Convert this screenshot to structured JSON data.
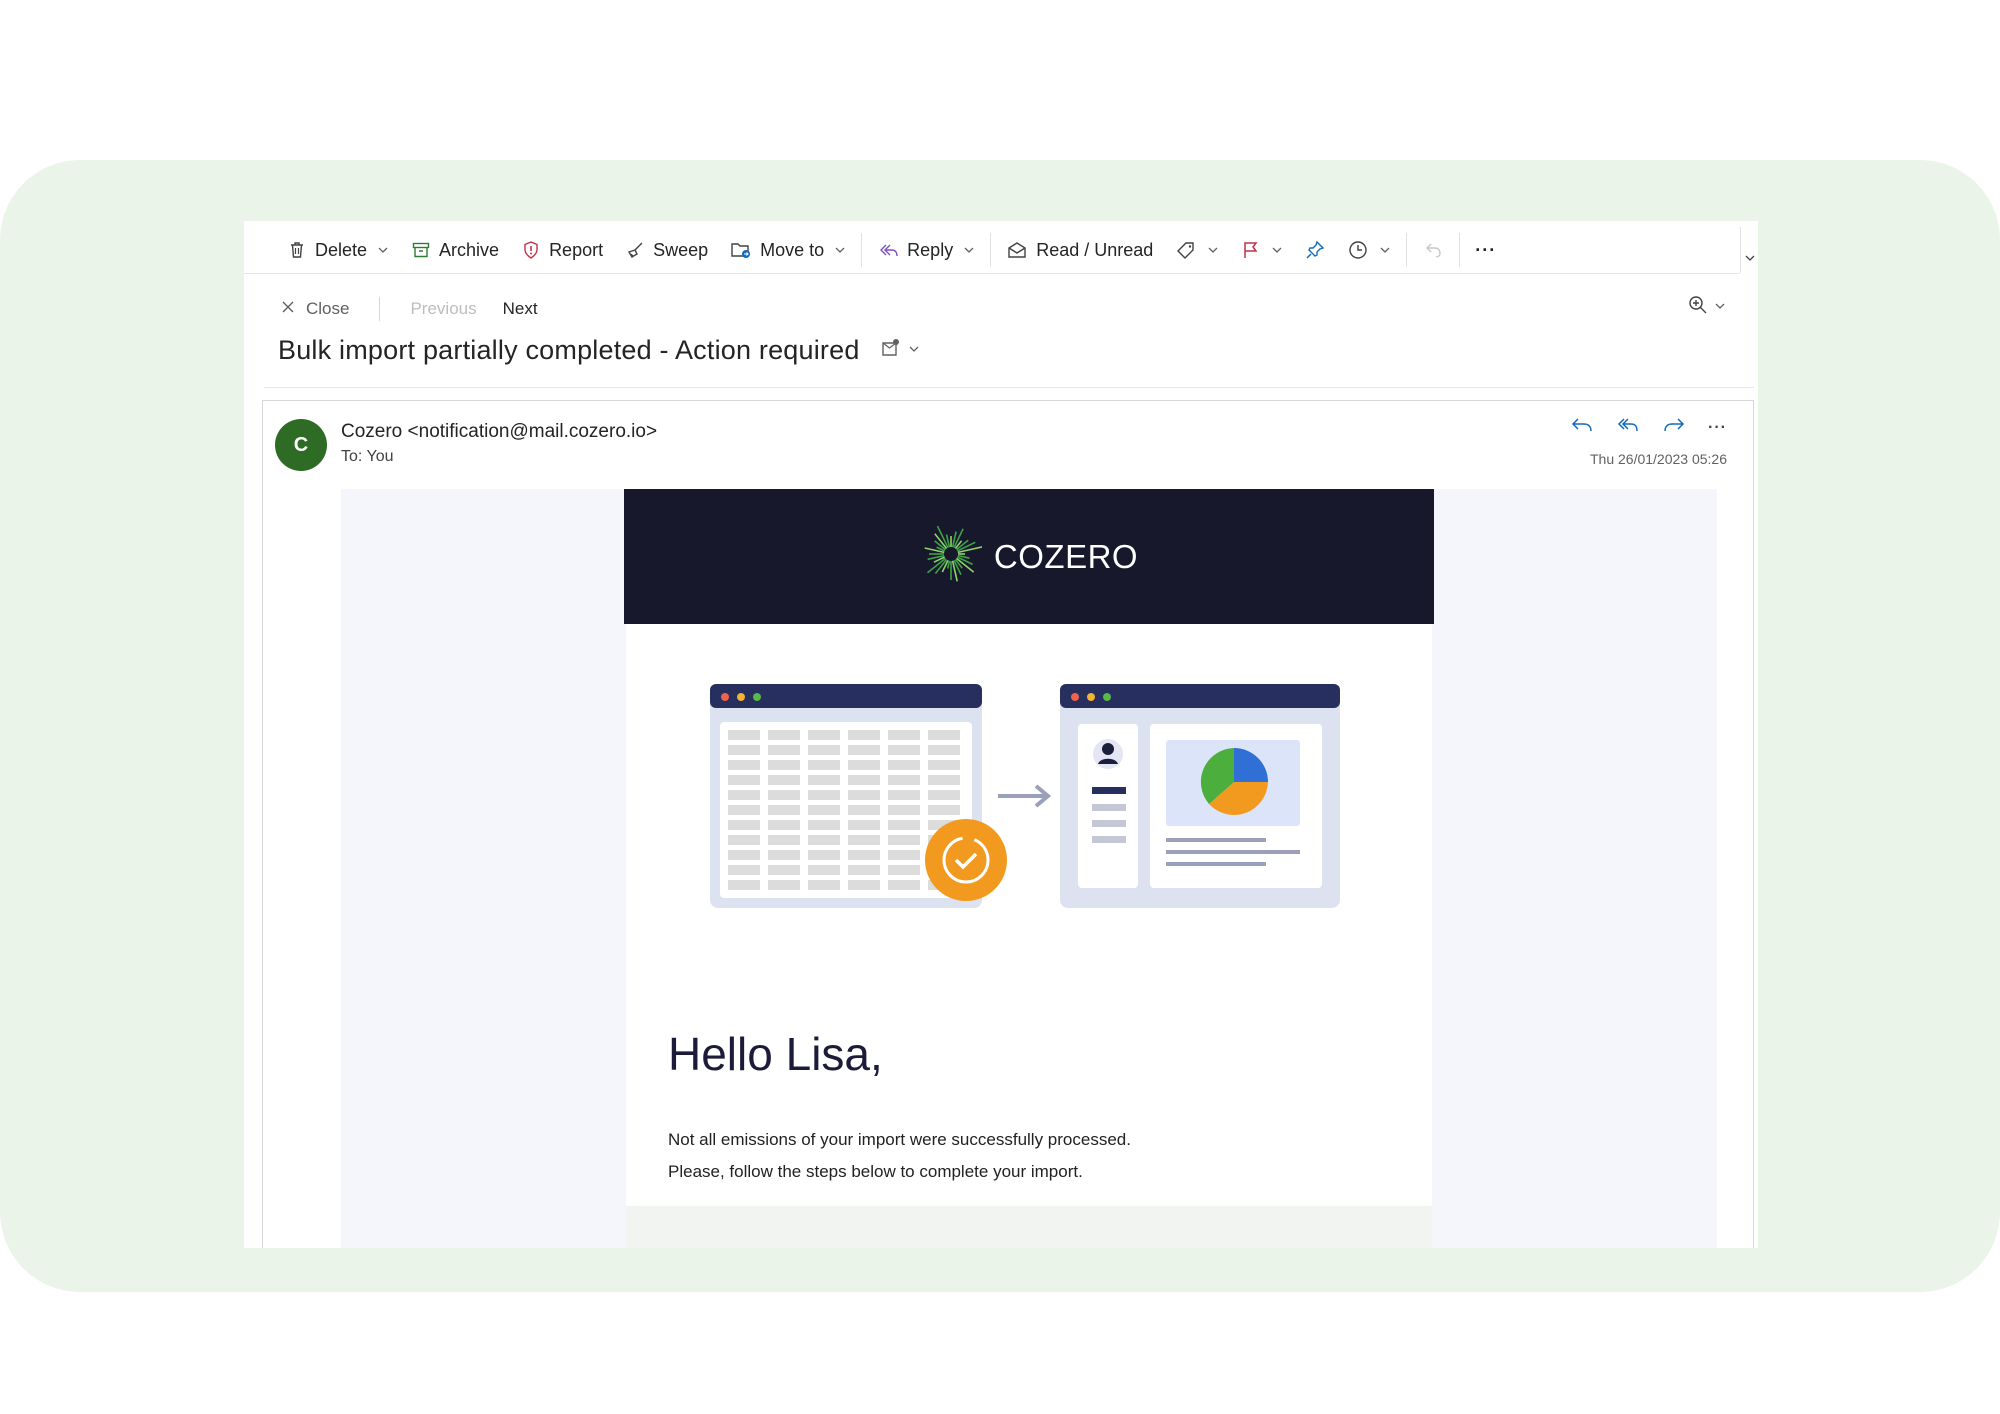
{
  "toolbar": {
    "delete_label": "Delete",
    "archive_label": "Archive",
    "report_label": "Report",
    "sweep_label": "Sweep",
    "move_to_label": "Move to",
    "reply_label": "Reply",
    "read_unread_label": "Read / Unread",
    "more_label": "···"
  },
  "nav": {
    "close_label": "Close",
    "previous_label": "Previous",
    "next_label": "Next"
  },
  "subject": "Bulk import partially completed - Action required",
  "message": {
    "avatar_initial": "C",
    "sender": "Cozero <notification@mail.cozero.io>",
    "to": "To:  You",
    "date": "Thu 26/01/2023 05:26",
    "more_label": "···"
  },
  "email": {
    "brand": "COZERO",
    "greeting": "Hello Lisa,",
    "line1": "Not all emissions of your import were successfully processed.",
    "line2": "Please, follow the steps below to complete your import."
  },
  "colors": {
    "backdrop": "#eaf4e8",
    "avatar": "#2e6b24",
    "email_header": "#17182b",
    "accent_orange": "#f29a1f",
    "accent_blue": "#2f6fd6",
    "accent_green": "#4cae3c"
  },
  "icons": [
    "trash-icon",
    "archive-icon",
    "shield-alert-icon",
    "broom-icon",
    "folder-move-icon",
    "reply-all-icon",
    "envelope-open-icon",
    "tag-icon",
    "flag-icon",
    "pin-icon",
    "clock-icon",
    "undo-icon",
    "close-icon",
    "zoom-icon",
    "reply-icon",
    "forward-icon"
  ]
}
